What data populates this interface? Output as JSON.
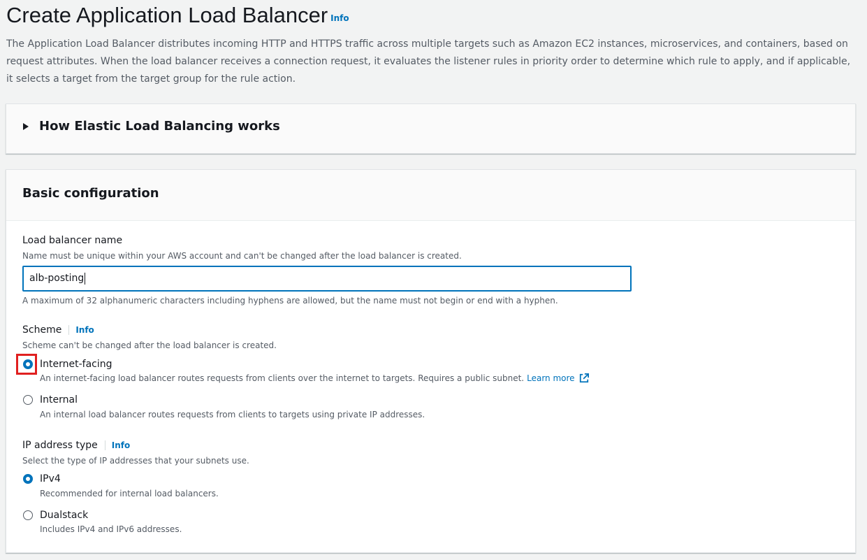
{
  "header": {
    "title": "Create Application Load Balancer",
    "info": "Info",
    "description": "The Application Load Balancer distributes incoming HTTP and HTTPS traffic across multiple targets such as Amazon EC2 instances, microservices, and containers, based on request attributes. When the load balancer receives a connection request, it evaluates the listener rules in priority order to determine which rule to apply, and if applicable, it selects a target from the target group for the rule action."
  },
  "how_it_works": {
    "label": "How Elastic Load Balancing works"
  },
  "basic": {
    "title": "Basic configuration",
    "name": {
      "label": "Load balancer name",
      "description": "Name must be unique within your AWS account and can't be changed after the load balancer is created.",
      "value": "alb-posting",
      "constraint": "A maximum of 32 alphanumeric characters including hyphens are allowed, but the name must not begin or end with a hyphen."
    },
    "scheme": {
      "label": "Scheme",
      "info": "Info",
      "description": "Scheme can't be changed after the load balancer is created.",
      "options": [
        {
          "label": "Internet-facing",
          "description": "An internet-facing load balancer routes requests from clients over the internet to targets. Requires a public subnet.",
          "link": "Learn more",
          "selected": true
        },
        {
          "label": "Internal",
          "description": "An internal load balancer routes requests from clients to targets using private IP addresses.",
          "selected": false
        }
      ]
    },
    "ip_type": {
      "label": "IP address type",
      "info": "Info",
      "description": "Select the type of IP addresses that your subnets use.",
      "options": [
        {
          "label": "IPv4",
          "description": "Recommended for internal load balancers.",
          "selected": true
        },
        {
          "label": "Dualstack",
          "description": "Includes IPv4 and IPv6 addresses.",
          "selected": false
        }
      ]
    }
  },
  "colors": {
    "accent": "#0073bb",
    "highlight": "#e02020"
  }
}
